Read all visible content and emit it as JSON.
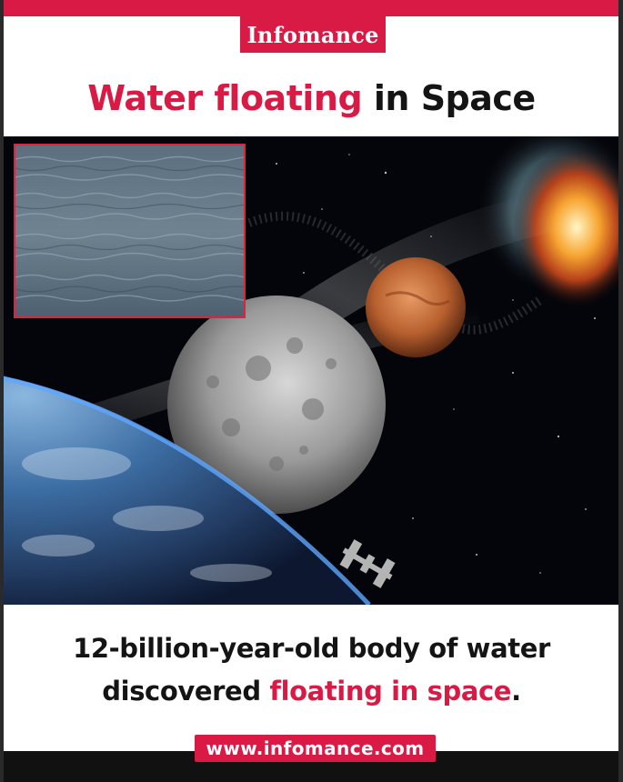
{
  "brand": {
    "name": "Infomance"
  },
  "headline": {
    "accent": "Water floating",
    "rest": " in Space"
  },
  "caption": {
    "line1": "12-billion-year-old body of water",
    "line2_start": "discovered ",
    "line2_accent": "floating in space",
    "line2_end": "."
  },
  "footer": {
    "url": "www.infomance.com"
  },
  "colors": {
    "accent": "#d91a45",
    "text": "#141414",
    "background": "#ffffff"
  },
  "images": {
    "hero": "space-scene-earth-moon-mars-nebula",
    "inset": "water-surface-photo"
  }
}
